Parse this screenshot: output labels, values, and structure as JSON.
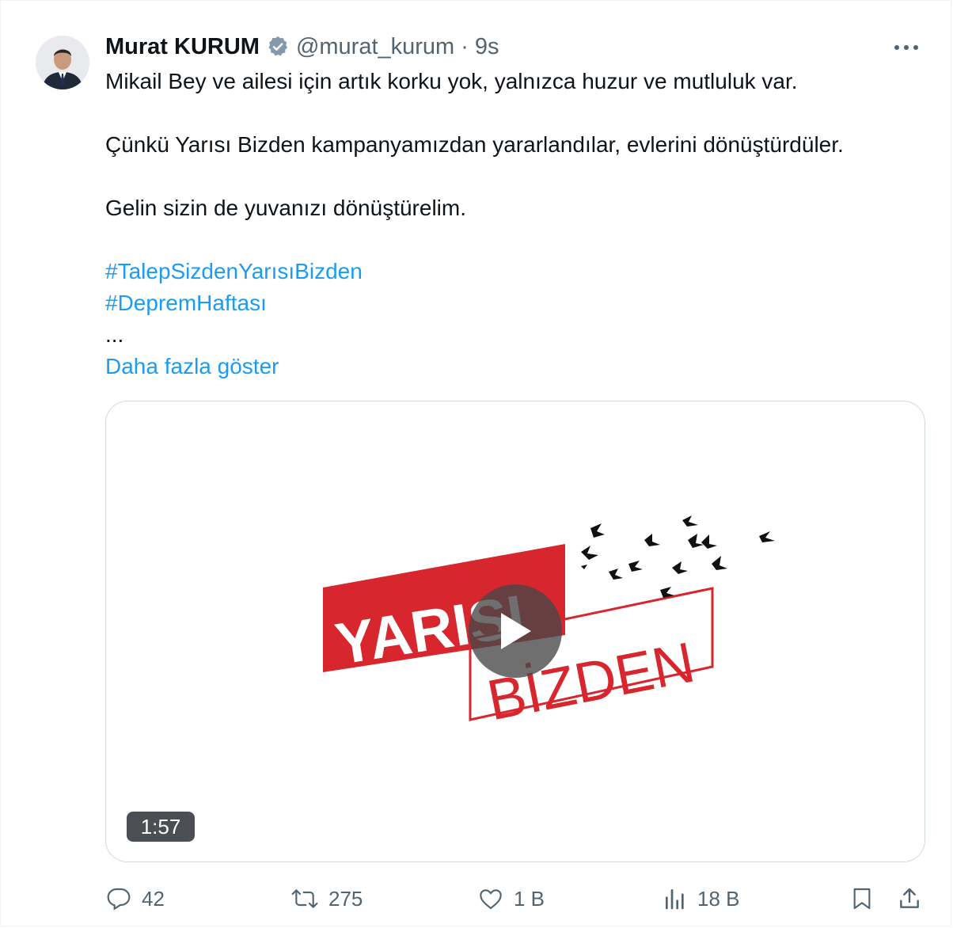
{
  "tweet": {
    "author_name": "Murat KURUM",
    "handle": "@murat_kurum",
    "separator": "·",
    "time": "9s",
    "lines": {
      "l1": "Mikail Bey ve ailesi için artık korku yok, yalnızca huzur ve mutluluk var.",
      "l2": "Çünkü Yarısı Bizden kampanyamızdan yararlandılar, evlerini dönüştürdüler.",
      "l3": "Gelin sizin de yuvanızı dönüştürelim."
    },
    "hashtags": [
      "#TalepSizdenYarısıBizden",
      "#DepremHaftası"
    ],
    "ellipsis": "...",
    "show_more": "Daha fazla göster"
  },
  "media": {
    "logo_word1": "YARISI",
    "logo_word2": "BİZDEN",
    "duration": "1:57",
    "logo_color": "#d7262e"
  },
  "actions": {
    "replies": "42",
    "reposts": "275",
    "likes": "1 B",
    "views": "18 B"
  },
  "colors": {
    "accent": "#1d9bf0",
    "secondary_text": "#536471",
    "verified_badge": "#829aab"
  },
  "icons": [
    "verified-badge-icon",
    "more-icon",
    "play-icon",
    "reply-icon",
    "repost-icon",
    "like-icon",
    "views-icon",
    "bookmark-icon",
    "share-icon"
  ]
}
